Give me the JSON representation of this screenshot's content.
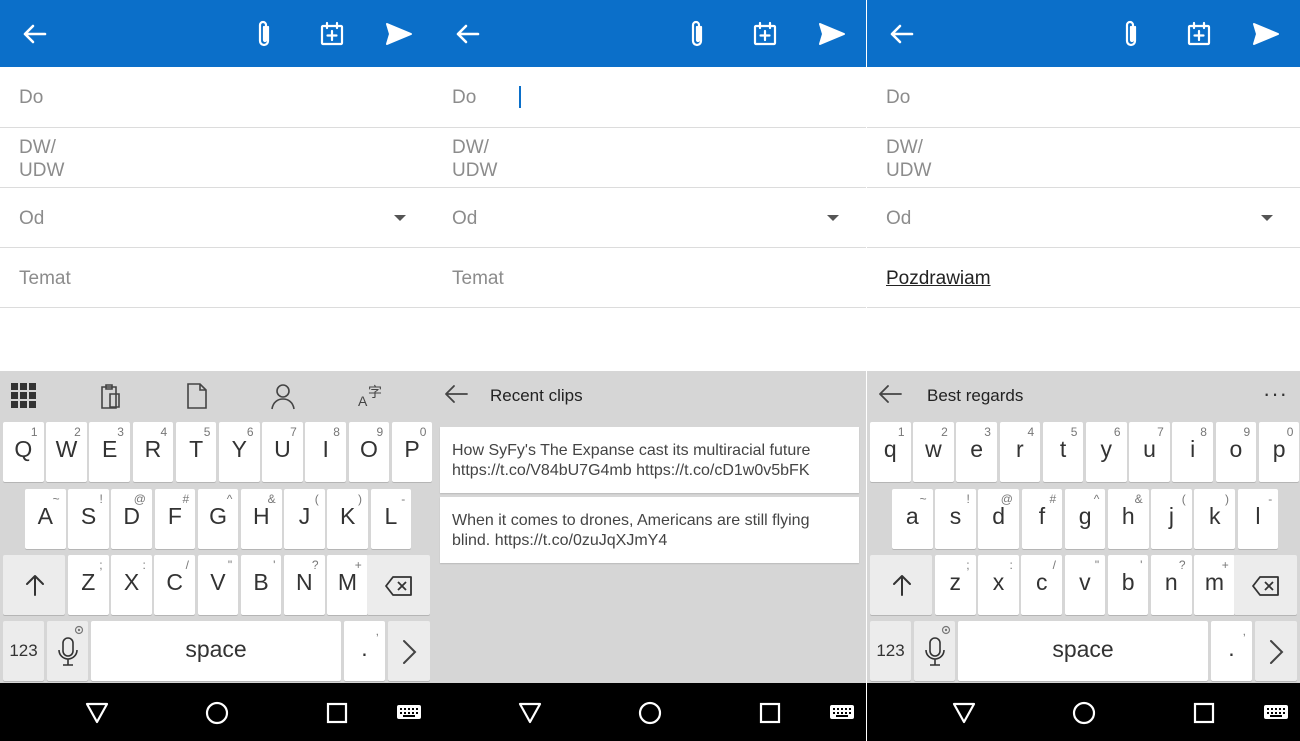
{
  "compose": {
    "to_label": "Do",
    "cc_label": "DW/\nUDW",
    "cc_line1": "DW/",
    "cc_line2": "UDW",
    "from_label": "Od",
    "subject_placeholder": "Temat",
    "subject_value_panel3": "Pozdrawiam"
  },
  "appbar": {
    "color": "#0b6fc9",
    "icons": [
      "back-arrow-icon",
      "paperclip-icon",
      "calendar-add-icon",
      "send-icon"
    ]
  },
  "keyboard_upper": {
    "row1": [
      [
        "Q",
        "1"
      ],
      [
        "W",
        "2"
      ],
      [
        "E",
        "3"
      ],
      [
        "R",
        "4"
      ],
      [
        "T",
        "5"
      ],
      [
        "Y",
        "6"
      ],
      [
        "U",
        "7"
      ],
      [
        "I",
        "8"
      ],
      [
        "O",
        "9"
      ],
      [
        "P",
        "0"
      ]
    ],
    "row2": [
      [
        "A",
        "~"
      ],
      [
        "S",
        "!"
      ],
      [
        "D",
        "@"
      ],
      [
        "F",
        "#"
      ],
      [
        "G",
        "^"
      ],
      [
        "H",
        "&"
      ],
      [
        "J",
        "("
      ],
      [
        "K",
        ")"
      ],
      [
        "L",
        "-"
      ]
    ],
    "row3": [
      [
        "Z",
        ";"
      ],
      [
        "X",
        ":"
      ],
      [
        "C",
        "/"
      ],
      [
        "V",
        "\""
      ],
      [
        "B",
        "'"
      ],
      [
        "N",
        "?"
      ],
      [
        "M",
        "+"
      ]
    ]
  },
  "keyboard_lower": {
    "row1": [
      [
        "q",
        "1"
      ],
      [
        "w",
        "2"
      ],
      [
        "e",
        "3"
      ],
      [
        "r",
        "4"
      ],
      [
        "t",
        "5"
      ],
      [
        "y",
        "6"
      ],
      [
        "u",
        "7"
      ],
      [
        "i",
        "8"
      ],
      [
        "o",
        "9"
      ],
      [
        "p",
        "0"
      ]
    ],
    "row2": [
      [
        "a",
        "~"
      ],
      [
        "s",
        "!"
      ],
      [
        "d",
        "@"
      ],
      [
        "f",
        "#"
      ],
      [
        "g",
        "^"
      ],
      [
        "h",
        "&"
      ],
      [
        "j",
        "("
      ],
      [
        "k",
        ")"
      ],
      [
        "l",
        "-"
      ]
    ],
    "row3": [
      [
        "z",
        ";"
      ],
      [
        "x",
        ":"
      ],
      [
        "c",
        "/"
      ],
      [
        "v",
        "\""
      ],
      [
        "b",
        "'"
      ],
      [
        "n",
        "?"
      ],
      [
        "m",
        "+"
      ]
    ]
  },
  "keyboard_common": {
    "num_label": "123",
    "space_label": "space",
    "period_label": ".",
    "period_sub": ","
  },
  "clips_panel": {
    "title": "Recent clips",
    "clips": [
      "How SyFy's The Expanse cast its multiracial future https://t.co/V84bU7G4mb https://t.co/cD1w0v5bFK",
      "When it comes to drones, Americans are still flying blind. https://t.co/0zuJqXJmY4"
    ]
  },
  "suggest_panel": {
    "title": "Best regards",
    "more": "···"
  }
}
